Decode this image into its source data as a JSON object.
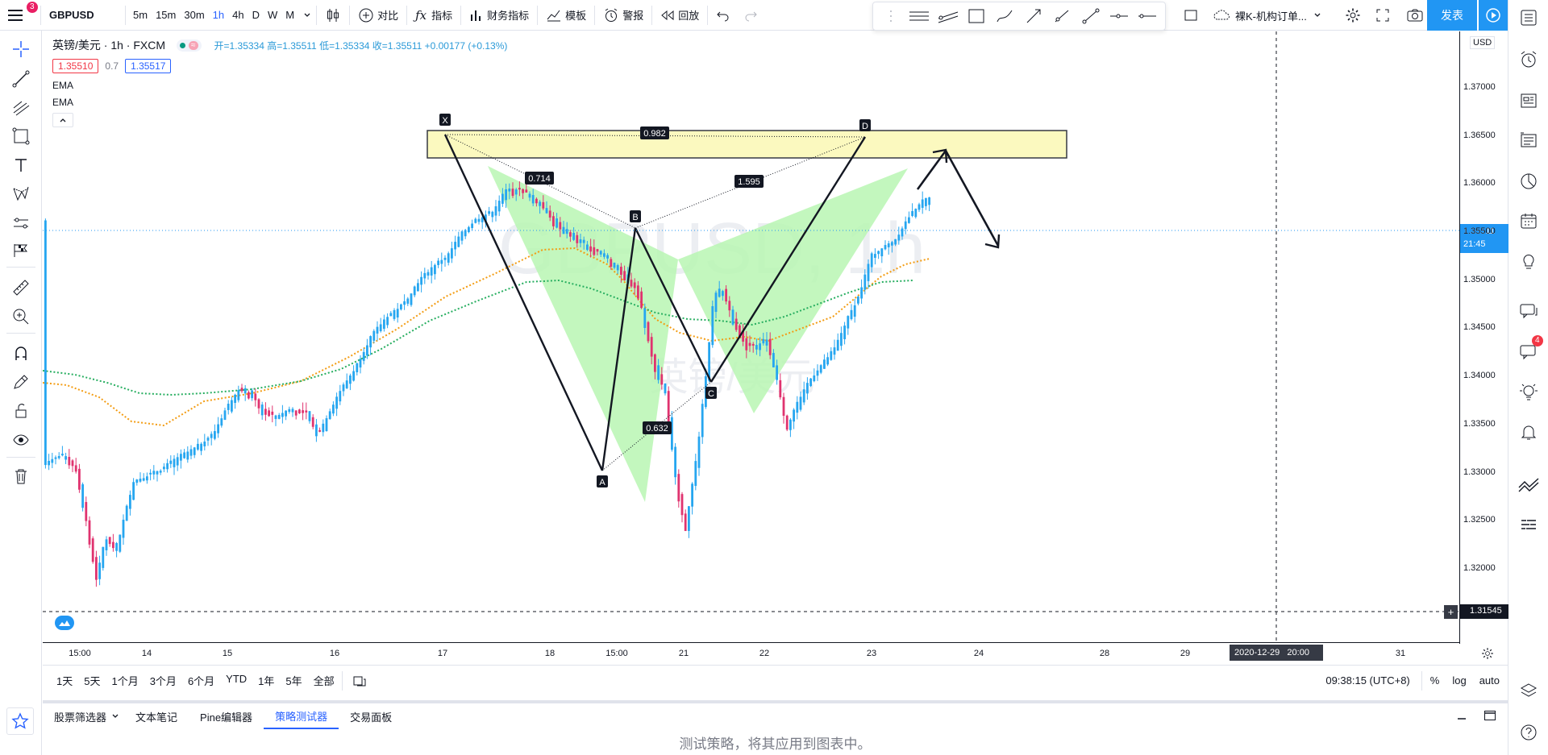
{
  "header": {
    "symbol": "GBPUSD",
    "intervals": [
      "5m",
      "15m",
      "30m",
      "1h",
      "4h",
      "D",
      "W",
      "M"
    ],
    "active_interval": "1h",
    "compare_label": "对比",
    "indicators_label": "指标",
    "financials_label": "财务指标",
    "templates_label": "模板",
    "alerts_label": "警报",
    "replay_label": "回放",
    "layout_name": "裸K-机构订单...",
    "publish_label": "发表",
    "menu_badge": "3"
  },
  "legend": {
    "title": "英镑/美元 · 1h · FXCM",
    "ohlc": "开=1.35334 高=1.35511 低=1.35334 收=1.35511 +0.00177 (+0.13%)",
    "bid": "1.35510",
    "spread": "0.7",
    "ask": "1.35517",
    "indicators": [
      "EMA",
      "EMA"
    ]
  },
  "watermark": {
    "symbol": "GBPUSD, 1h",
    "name": "英镑/美元"
  },
  "price_axis": {
    "currency": "USD",
    "labels": [
      "1.37000",
      "1.36500",
      "1.36000",
      "1.35500",
      "1.35000",
      "1.34500",
      "1.34000",
      "1.33500",
      "1.33000",
      "1.32500",
      "1.32000"
    ],
    "current_price": "1.35511",
    "countdown": "21:45",
    "crosshair_price": "1.31545"
  },
  "time_axis": {
    "labels": [
      "15:00",
      "14",
      "15",
      "16",
      "17",
      "18",
      "15:00",
      "21",
      "22",
      "23",
      "24",
      "28",
      "29",
      "31"
    ],
    "crosshair_time": "2020-12-29   20:00"
  },
  "pattern": {
    "points": [
      "X",
      "A",
      "B",
      "C",
      "D"
    ],
    "ratios": {
      "xb": "0.714",
      "xd": "0.982",
      "bd": "1.595",
      "ac": "0.632"
    }
  },
  "bottom_bar": {
    "ranges": [
      "1天",
      "5天",
      "1个月",
      "3个月",
      "6个月",
      "YTD",
      "1年",
      "5年",
      "全部"
    ],
    "clock": "09:38:15 (UTC+8)",
    "percent": "%",
    "log": "log",
    "auto": "auto"
  },
  "panel": {
    "tabs": [
      "股票筛选器",
      "文本笔记",
      "Pine编辑器",
      "策略测试器",
      "交易面板"
    ],
    "active_tab": "策略测试器",
    "message": "测试策略，将其应用到图表中。"
  },
  "right_badge": "4",
  "colors": {
    "up": "#26a6f0",
    "down": "#e0336f",
    "ema_fast": "#f39c12",
    "ema_slow": "#27ae60",
    "pattern_fill": "#b9f6b3",
    "zone_fill": "#fbf9b5",
    "accent": "#2196f3"
  }
}
